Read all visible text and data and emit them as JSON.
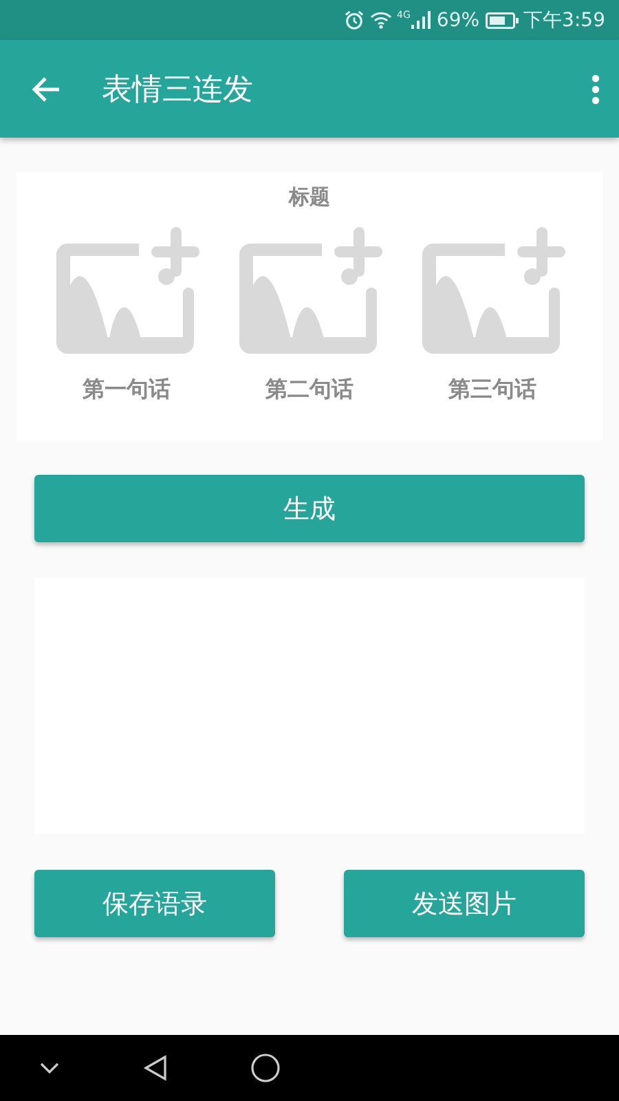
{
  "status_bar": {
    "network": "4G",
    "battery": "69%",
    "time": "下午3:59"
  },
  "app_bar": {
    "title": "表情三连发"
  },
  "card": {
    "title": "标题",
    "slots": [
      {
        "label": "第一句话"
      },
      {
        "label": "第二句话"
      },
      {
        "label": "第三句话"
      }
    ]
  },
  "generate_button": "生成",
  "actions": [
    "保存语录",
    "发送图片"
  ]
}
